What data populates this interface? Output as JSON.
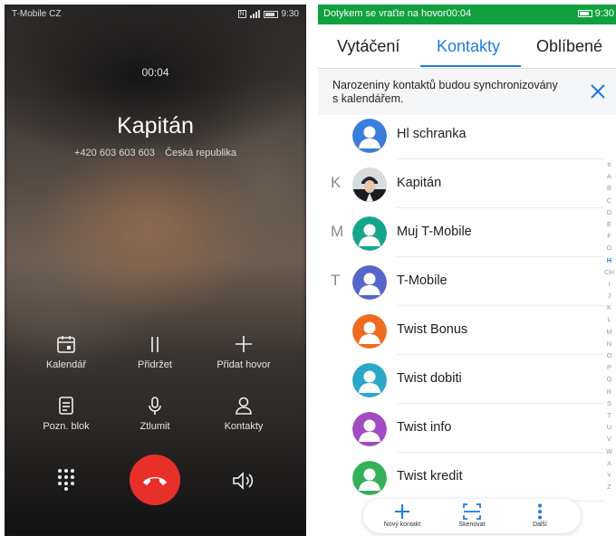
{
  "left": {
    "status": {
      "carrier": "T-Mobile CZ",
      "time": "9:30"
    },
    "call": {
      "timer": "00:04",
      "name": "Kapitán",
      "number": "+420 603 603 603",
      "country": "Česká republika"
    },
    "buttons": {
      "calendar": "Kalendář",
      "hold": "Přidržet",
      "add_call": "Přidat hovor",
      "notepad": "Pozn. blok",
      "mute": "Ztlumit",
      "contacts": "Kontakty"
    },
    "colors": {
      "end_call": "#e8302a"
    }
  },
  "right": {
    "status": {
      "text": "Dotykem se vraťte na hovor00:04",
      "time": "9:30",
      "bar_color": "#10a03d"
    },
    "tabs": [
      "Vytáčení",
      "Kontakty",
      "Oblíbené"
    ],
    "active_tab": "Kontakty",
    "banner": {
      "text": "Narozeniny kontaktů budou synchronizovány s kalendářem."
    },
    "contacts": [
      {
        "letter": "",
        "name": "Hl schranka",
        "avatar": "blue-person"
      },
      {
        "letter": "K",
        "name": "Kapitán",
        "avatar": "photo"
      },
      {
        "letter": "M",
        "name": "Muj T-Mobile",
        "avatar": "teal-person"
      },
      {
        "letter": "T",
        "name": "T-Mobile",
        "avatar": "indigo-person"
      },
      {
        "letter": "",
        "name": "Twist Bonus",
        "avatar": "orange-person"
      },
      {
        "letter": "",
        "name": "Twist dobiti",
        "avatar": "cyan-person"
      },
      {
        "letter": "",
        "name": "Twist info",
        "avatar": "purple-person"
      },
      {
        "letter": "",
        "name": "Twist kredit",
        "avatar": "green-person"
      }
    ],
    "index_letters": [
      "#",
      "A",
      "B",
      "C",
      "D",
      "E",
      "F",
      "G",
      "H",
      "CH",
      "I",
      "J",
      "K",
      "L",
      "M",
      "N",
      "O",
      "P",
      "Q",
      "R",
      "S",
      "T",
      "U",
      "V",
      "W",
      "X",
      "Y",
      "Z"
    ],
    "index_active": "H",
    "bottom_bar": {
      "new_contact": "Nový kontakt",
      "scan": "Skenovat",
      "more": "Další"
    },
    "avatar_colors": {
      "blue-person": "#3b7ddd",
      "teal-person": "#17a58a",
      "indigo-person": "#5566c8",
      "orange-person": "#ef6a1f",
      "cyan-person": "#2aa8c9",
      "purple-person": "#a24bc2",
      "green-person": "#34b15a"
    },
    "accent": "#1f7be0"
  }
}
